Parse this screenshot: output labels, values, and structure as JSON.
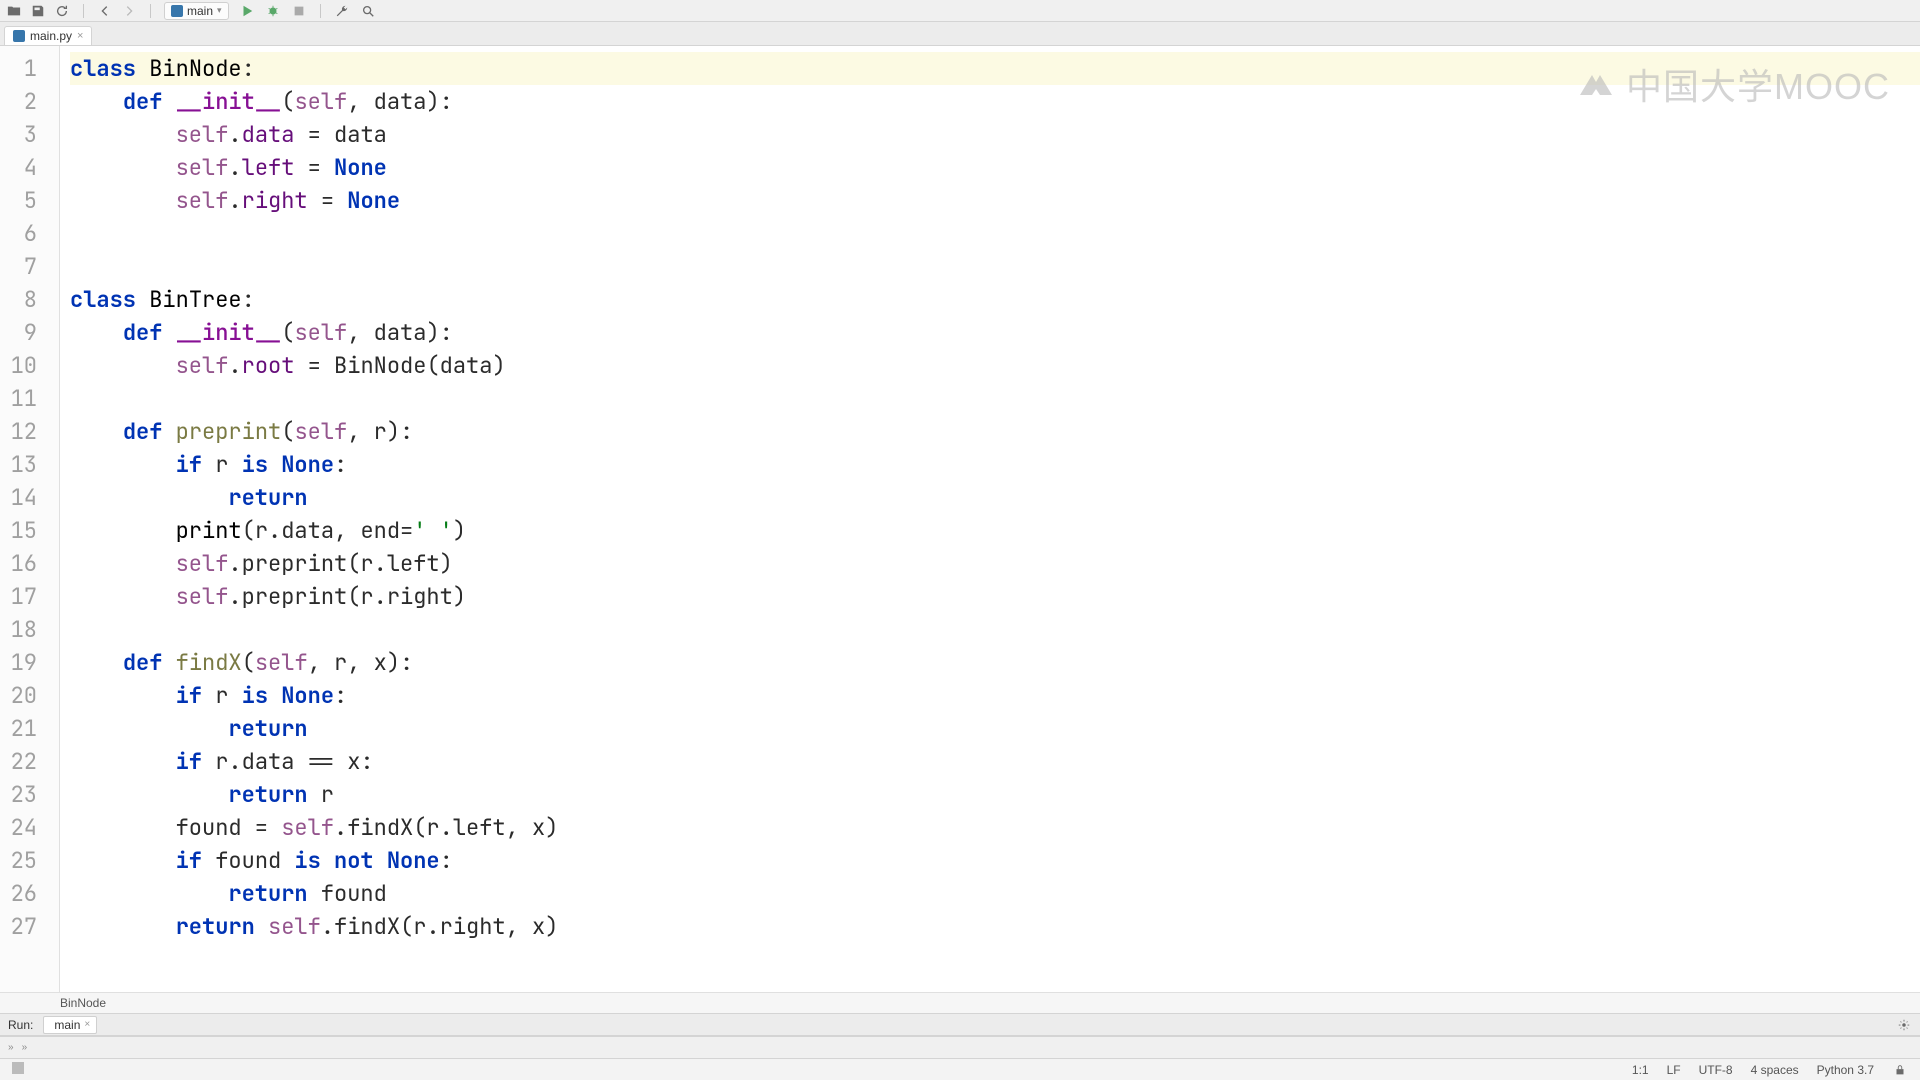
{
  "toolbar": {
    "run_config_label": "main"
  },
  "file_tab": {
    "name": "main.py"
  },
  "watermark_text": "中国大学MOOC",
  "breadcrumb": "BinNode",
  "run_panel": {
    "label": "Run:",
    "tab": "main"
  },
  "statusbar": {
    "position": "1:1",
    "line_ending": "LF",
    "encoding": "UTF-8",
    "indent": "4 spaces",
    "interpreter": "Python 3.7"
  },
  "code": {
    "lines": 27,
    "tokens": [
      {
        "n": 1,
        "hl": true,
        "parts": [
          [
            "kw",
            "class"
          ],
          [
            "p",
            " "
          ],
          [
            "cls",
            "BinNode"
          ],
          [
            "p",
            ":"
          ]
        ]
      },
      {
        "n": 2,
        "parts": [
          [
            "p",
            "    "
          ],
          [
            "def",
            "def"
          ],
          [
            "p",
            " "
          ],
          [
            "init",
            "__init__"
          ],
          [
            "p",
            "("
          ],
          [
            "self",
            "self"
          ],
          [
            "p",
            ", data):"
          ]
        ]
      },
      {
        "n": 3,
        "parts": [
          [
            "p",
            "        "
          ],
          [
            "self",
            "self"
          ],
          [
            "p",
            "."
          ],
          [
            "attr",
            "data"
          ],
          [
            "p",
            " = data"
          ]
        ]
      },
      {
        "n": 4,
        "parts": [
          [
            "p",
            "        "
          ],
          [
            "self",
            "self"
          ],
          [
            "p",
            "."
          ],
          [
            "attr",
            "left"
          ],
          [
            "p",
            " = "
          ],
          [
            "none",
            "None"
          ]
        ]
      },
      {
        "n": 5,
        "parts": [
          [
            "p",
            "        "
          ],
          [
            "self",
            "self"
          ],
          [
            "p",
            "."
          ],
          [
            "attr",
            "right"
          ],
          [
            "p",
            " = "
          ],
          [
            "none",
            "None"
          ]
        ]
      },
      {
        "n": 6,
        "parts": [
          [
            "p",
            ""
          ]
        ]
      },
      {
        "n": 7,
        "parts": [
          [
            "p",
            ""
          ]
        ]
      },
      {
        "n": 8,
        "parts": [
          [
            "kw",
            "class"
          ],
          [
            "p",
            " "
          ],
          [
            "cls",
            "BinTree"
          ],
          [
            "p",
            ":"
          ]
        ]
      },
      {
        "n": 9,
        "parts": [
          [
            "p",
            "    "
          ],
          [
            "def",
            "def"
          ],
          [
            "p",
            " "
          ],
          [
            "init",
            "__init__"
          ],
          [
            "p",
            "("
          ],
          [
            "self",
            "self"
          ],
          [
            "p",
            ", data):"
          ]
        ]
      },
      {
        "n": 10,
        "parts": [
          [
            "p",
            "        "
          ],
          [
            "self",
            "self"
          ],
          [
            "p",
            "."
          ],
          [
            "attr",
            "root"
          ],
          [
            "p",
            " = BinNode(data)"
          ]
        ]
      },
      {
        "n": 11,
        "parts": [
          [
            "p",
            ""
          ]
        ]
      },
      {
        "n": 12,
        "parts": [
          [
            "p",
            "    "
          ],
          [
            "def",
            "def"
          ],
          [
            "p",
            " "
          ],
          [
            "fn",
            "preprint"
          ],
          [
            "p",
            "("
          ],
          [
            "self",
            "self"
          ],
          [
            "p",
            ", r):"
          ]
        ]
      },
      {
        "n": 13,
        "parts": [
          [
            "p",
            "        "
          ],
          [
            "kw",
            "if"
          ],
          [
            "p",
            " r "
          ],
          [
            "kw",
            "is"
          ],
          [
            "p",
            " "
          ],
          [
            "none",
            "None"
          ],
          [
            "p",
            ":"
          ]
        ]
      },
      {
        "n": 14,
        "parts": [
          [
            "p",
            "            "
          ],
          [
            "kw",
            "return"
          ]
        ]
      },
      {
        "n": 15,
        "parts": [
          [
            "p",
            "        "
          ],
          [
            "bi",
            "print"
          ],
          [
            "p",
            "(r.data, "
          ],
          [
            "param",
            "end"
          ],
          [
            "p",
            "="
          ],
          [
            "str",
            "' '"
          ],
          [
            "p",
            ")"
          ]
        ]
      },
      {
        "n": 16,
        "parts": [
          [
            "p",
            "        "
          ],
          [
            "self",
            "self"
          ],
          [
            "p",
            ".preprint(r.left)"
          ]
        ]
      },
      {
        "n": 17,
        "parts": [
          [
            "p",
            "        "
          ],
          [
            "self",
            "self"
          ],
          [
            "p",
            ".preprint(r.right)"
          ]
        ]
      },
      {
        "n": 18,
        "parts": [
          [
            "p",
            ""
          ]
        ]
      },
      {
        "n": 19,
        "parts": [
          [
            "p",
            "    "
          ],
          [
            "def",
            "def"
          ],
          [
            "p",
            " "
          ],
          [
            "fn",
            "findX"
          ],
          [
            "p",
            "("
          ],
          [
            "self",
            "self"
          ],
          [
            "p",
            ", r, x):"
          ]
        ]
      },
      {
        "n": 20,
        "parts": [
          [
            "p",
            "        "
          ],
          [
            "kw",
            "if"
          ],
          [
            "p",
            " r "
          ],
          [
            "kw",
            "is"
          ],
          [
            "p",
            " "
          ],
          [
            "none",
            "None"
          ],
          [
            "p",
            ":"
          ]
        ]
      },
      {
        "n": 21,
        "parts": [
          [
            "p",
            "            "
          ],
          [
            "kw",
            "return"
          ]
        ]
      },
      {
        "n": 22,
        "parts": [
          [
            "p",
            "        "
          ],
          [
            "kw",
            "if"
          ],
          [
            "p",
            " r.data == x:"
          ]
        ]
      },
      {
        "n": 23,
        "parts": [
          [
            "p",
            "            "
          ],
          [
            "kw",
            "return"
          ],
          [
            "p",
            " r"
          ]
        ]
      },
      {
        "n": 24,
        "parts": [
          [
            "p",
            "        found = "
          ],
          [
            "self",
            "self"
          ],
          [
            "p",
            ".findX(r.left, x)"
          ]
        ]
      },
      {
        "n": 25,
        "parts": [
          [
            "p",
            "        "
          ],
          [
            "kw",
            "if"
          ],
          [
            "p",
            " found "
          ],
          [
            "kw",
            "is not"
          ],
          [
            "p",
            " "
          ],
          [
            "none",
            "None"
          ],
          [
            "p",
            ":"
          ]
        ]
      },
      {
        "n": 26,
        "parts": [
          [
            "p",
            "            "
          ],
          [
            "kw",
            "return"
          ],
          [
            "p",
            " found"
          ]
        ]
      },
      {
        "n": 27,
        "parts": [
          [
            "p",
            "        "
          ],
          [
            "kw",
            "return"
          ],
          [
            "p",
            " "
          ],
          [
            "self",
            "self"
          ],
          [
            "p",
            ".findX(r.right, x)"
          ]
        ]
      }
    ]
  }
}
